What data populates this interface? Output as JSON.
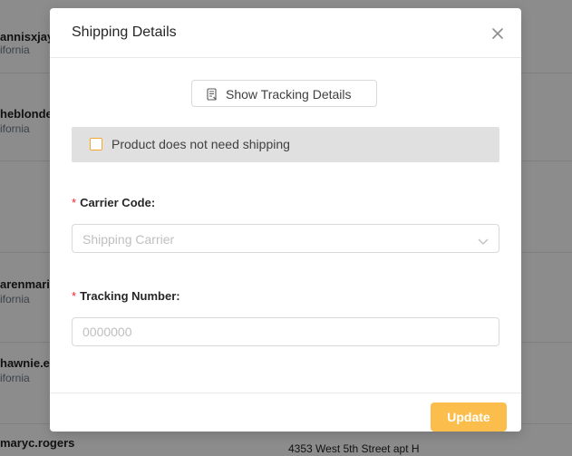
{
  "background": {
    "rows": [
      {
        "name": "annisxjay",
        "state": "ifornia"
      },
      {
        "name": "heblonde",
        "state": "ifornia"
      },
      {
        "name": "",
        "state": ""
      },
      {
        "name": "arenmari",
        "state": "ifornia"
      },
      {
        "name": "hawnie.ea",
        "state": "ifornia"
      },
      {
        "name": "maryc.rogers",
        "state": ""
      }
    ],
    "address": "4353 West 5th Street apt H"
  },
  "modal": {
    "title": "Shipping Details",
    "show_tracking_label": "Show Tracking Details",
    "no_shipping_label": "Product does not need shipping",
    "carrier_label": "Carrier Code",
    "carrier_placeholder": "Shipping Carrier",
    "tracking_label": "Tracking Number",
    "tracking_placeholder": "0000000",
    "required_mark": "*",
    "colon": ":",
    "update_label": "Update"
  },
  "colors": {
    "accent": "#fbbd4c",
    "required": "#f5222d",
    "checkbox_border": "#f0a830"
  },
  "icons": {
    "close": "close-icon",
    "tracking": "document-list-icon",
    "select_arrow": "chevron-down-icon"
  }
}
